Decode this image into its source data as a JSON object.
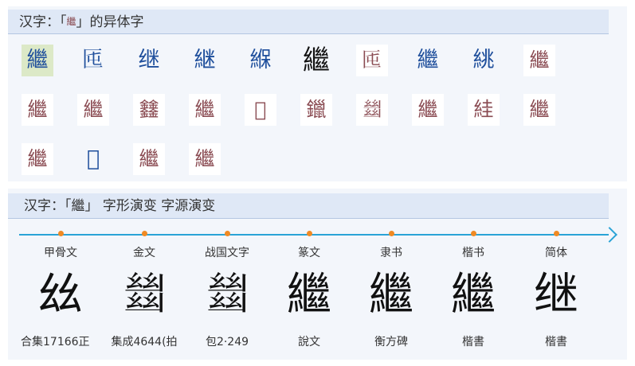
{
  "variants_panel": {
    "title_prefix": "汉字：「",
    "title_char": "繼",
    "title_suffix": "」的异体字",
    "variants": [
      "繼",
      "𠤲",
      "继",
      "継",
      "緥",
      "繼",
      "𠤲",
      "繼",
      "絩",
      "繼",
      "繼",
      "繼",
      "𨰻",
      "繼",
      "𦀪",
      "鑞",
      "𢇍",
      "繼",
      "絓",
      "繼",
      "繼",
      "𡿟",
      "繼",
      "繼"
    ]
  },
  "evolution_panel": {
    "title": "汉字：「繼」 字形演变 字源演变",
    "stages": [
      {
        "era": "甲骨文",
        "glyph": "𢆶",
        "source": "合集17166正"
      },
      {
        "era": "金文",
        "glyph": "𢇍",
        "source": "集成4644(拍"
      },
      {
        "era": "战国文字",
        "glyph": "𢇍",
        "source": "包2·249"
      },
      {
        "era": "篆文",
        "glyph": "繼",
        "source": "說文"
      },
      {
        "era": "隶书",
        "glyph": "繼",
        "source": "衡方碑"
      },
      {
        "era": "楷书",
        "glyph": "繼",
        "source": "楷書"
      },
      {
        "era": "简体",
        "glyph": "继",
        "source": "楷書"
      }
    ]
  },
  "colors": {
    "accent": "#2aa3d6",
    "dot": "#f08a24",
    "header_bg": "#dfe8f6",
    "selected_bg": "#dce9c7"
  }
}
